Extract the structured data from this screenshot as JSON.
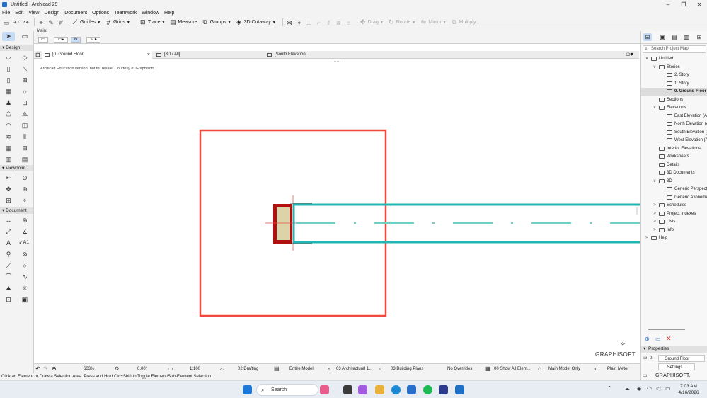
{
  "window": {
    "title": "Untitled - Archicad 29",
    "controls": [
      "–",
      "❐",
      "✕"
    ]
  },
  "menu": [
    "File",
    "Edit",
    "View",
    "Design",
    "Document",
    "Options",
    "Teamwork",
    "Window",
    "Help"
  ],
  "toolbar": {
    "guides": "Guides",
    "grids": "Grids",
    "trace": "Trace",
    "measure": "Measure",
    "groups": "Groups",
    "cutaway": "3D Cutaway",
    "drag": "Drag",
    "rotate": "Rotate",
    "mirror": "Mirror",
    "multiply": "Multiply..."
  },
  "infobox": {
    "main_label": "Main:"
  },
  "toolbox": {
    "categories": {
      "design": "Design",
      "viewpoint": "Viewpoint",
      "document": "Document"
    },
    "document_labels": {
      "a1": "A1"
    }
  },
  "tabs": [
    {
      "label": "[0. Ground Floor]",
      "active": true
    },
    {
      "label": "[3D / All]",
      "active": false
    },
    {
      "label": "[South Elevation]",
      "active": false
    }
  ],
  "canvas": {
    "notice": "Archicad Education version, not for resale. Courtesy of Graphisoft.",
    "brand": "GRAPHISOFT."
  },
  "bottombar": {
    "zoom": "603%",
    "angle": "0.00°",
    "scale": "1:100",
    "pen_set": "02 Drafting",
    "model_view": "Entire Model",
    "layer_combo": "03 Architectural 1...",
    "view": "03 Building Plans",
    "overrides": "No Overrides",
    "renovation": "00 Show All Elem...",
    "structure": "Main Model Only",
    "unit": "Plain Meter"
  },
  "status": "Click an Element or Draw a Selection Area. Press and Hold Ctrl+Shift to Toggle Element/Sub-Element Selection.",
  "navigator": {
    "search_placeholder": "Search Project Map",
    "tree": [
      {
        "label": "Untitled",
        "level": 0,
        "tw": "∨"
      },
      {
        "label": "Stories",
        "level": 1,
        "tw": "∨"
      },
      {
        "label": "2. Story",
        "level": 2,
        "tw": ""
      },
      {
        "label": "1. Story",
        "level": 2,
        "tw": ""
      },
      {
        "label": "0. Ground Floor",
        "level": 2,
        "tw": "",
        "selected": true
      },
      {
        "label": "Sections",
        "level": 1,
        "tw": ""
      },
      {
        "label": "Elevations",
        "level": 1,
        "tw": "∨"
      },
      {
        "label": "East Elevation (Auto-re",
        "level": 2,
        "tw": ""
      },
      {
        "label": "North Elevation (Auto-",
        "level": 2,
        "tw": ""
      },
      {
        "label": "South Elevation (Auto-",
        "level": 2,
        "tw": ""
      },
      {
        "label": "West Elevation (Auto-re",
        "level": 2,
        "tw": ""
      },
      {
        "label": "Interior Elevations",
        "level": 1,
        "tw": ""
      },
      {
        "label": "Worksheets",
        "level": 1,
        "tw": ""
      },
      {
        "label": "Details",
        "level": 1,
        "tw": ""
      },
      {
        "label": "3D Documents",
        "level": 1,
        "tw": ""
      },
      {
        "label": "3D",
        "level": 1,
        "tw": "∨"
      },
      {
        "label": "Generic Perspective",
        "level": 2,
        "tw": ""
      },
      {
        "label": "Generic Axonometry",
        "level": 2,
        "tw": ""
      },
      {
        "label": "Schedules",
        "level": 1,
        "tw": ">"
      },
      {
        "label": "Project Indexes",
        "level": 1,
        "tw": ">"
      },
      {
        "label": "Lists",
        "level": 1,
        "tw": ">"
      },
      {
        "label": "Info",
        "level": 1,
        "tw": ">"
      },
      {
        "label": "Help",
        "level": 0,
        "tw": ">"
      }
    ],
    "properties": {
      "header": "Properties",
      "story_num": "0.",
      "story_name": "Ground Floor",
      "settings": "Settings..."
    },
    "brand": "GRAPHISOFT."
  },
  "taskbar": {
    "search": "Search",
    "time": "7:03 AM",
    "date": "4/16/2026"
  },
  "colors": {
    "selection_red": "#f04a3e",
    "wall_teal": "#21b6b2",
    "column_red": "#b01010",
    "column_fill": "#ddd3a8"
  }
}
